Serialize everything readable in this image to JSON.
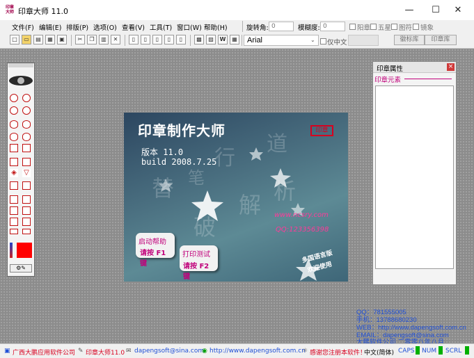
{
  "window": {
    "title": "印章大师 11.0",
    "app_icon_text": "印章\n大师",
    "minimize": "—",
    "maximize": "☐",
    "close": "✕"
  },
  "menu": [
    "文件(F)",
    "编辑(E)",
    "排版(P)",
    "选项(O)",
    "查看(V)",
    "工具(T)",
    "窗口(W)",
    "帮助(H)"
  ],
  "controls": {
    "rotate_label": "旋转角:",
    "rotate_value": "0",
    "blur_label": "模糊度:",
    "blur_value": "0",
    "check_yang": "阳章",
    "check_star": "五星",
    "check_symbol": "图符",
    "check_mirror": "镜象",
    "tab_phrase": "徽标库",
    "tab_stamp": "印章库",
    "font_name": "Arial",
    "check_chinese_only": "仅中文"
  },
  "splash": {
    "title": "印章制作大师",
    "version": "版本 11.0",
    "build": "build 2008.7.25",
    "stamp_label": "印章",
    "website": "www.ncsry.com",
    "qq": "QQ:123356398",
    "help_label": "启动帮助",
    "help_key": "请按 F1 键",
    "print_label": "打印测试",
    "print_key": "请按 F2 键",
    "multilang_1": "多国语言版",
    "multilang_2": "欢迎使用",
    "watermark_1": "笔",
    "watermark_2": "行",
    "watermark_3": "道",
    "watermark_4": "解",
    "watermark_5": "破",
    "watermark_6": "析",
    "watermark_7": "替"
  },
  "props_panel": {
    "title": "印章属性",
    "close": "×",
    "section": "印章元素"
  },
  "info": {
    "qq": "QQ：781555005",
    "phone": "手机：13788680230",
    "web": "WEB：http://www.dapengsoft.com.cn",
    "email": "EMAIL：dapengsoft@sina.com",
    "company": "大鹏软件公司  二零零八年八月"
  },
  "status": {
    "company": "广西大鹏应用软件公司",
    "app": "印章大师11.0",
    "email": "dapengsoft@sina.com",
    "url": "http://www.dapengsoft.com.cn",
    "thanks": "感谢您注册本软件！",
    "lang": "中文(简体)",
    "caps": "CAPS",
    "num": "NUM",
    "scrl": "SCRL"
  },
  "colors": {
    "accent_red": "#d8001f",
    "splash_pink": "#c0007a",
    "link_blue": "#1f4fd6",
    "indicator_green": "#00b000"
  }
}
